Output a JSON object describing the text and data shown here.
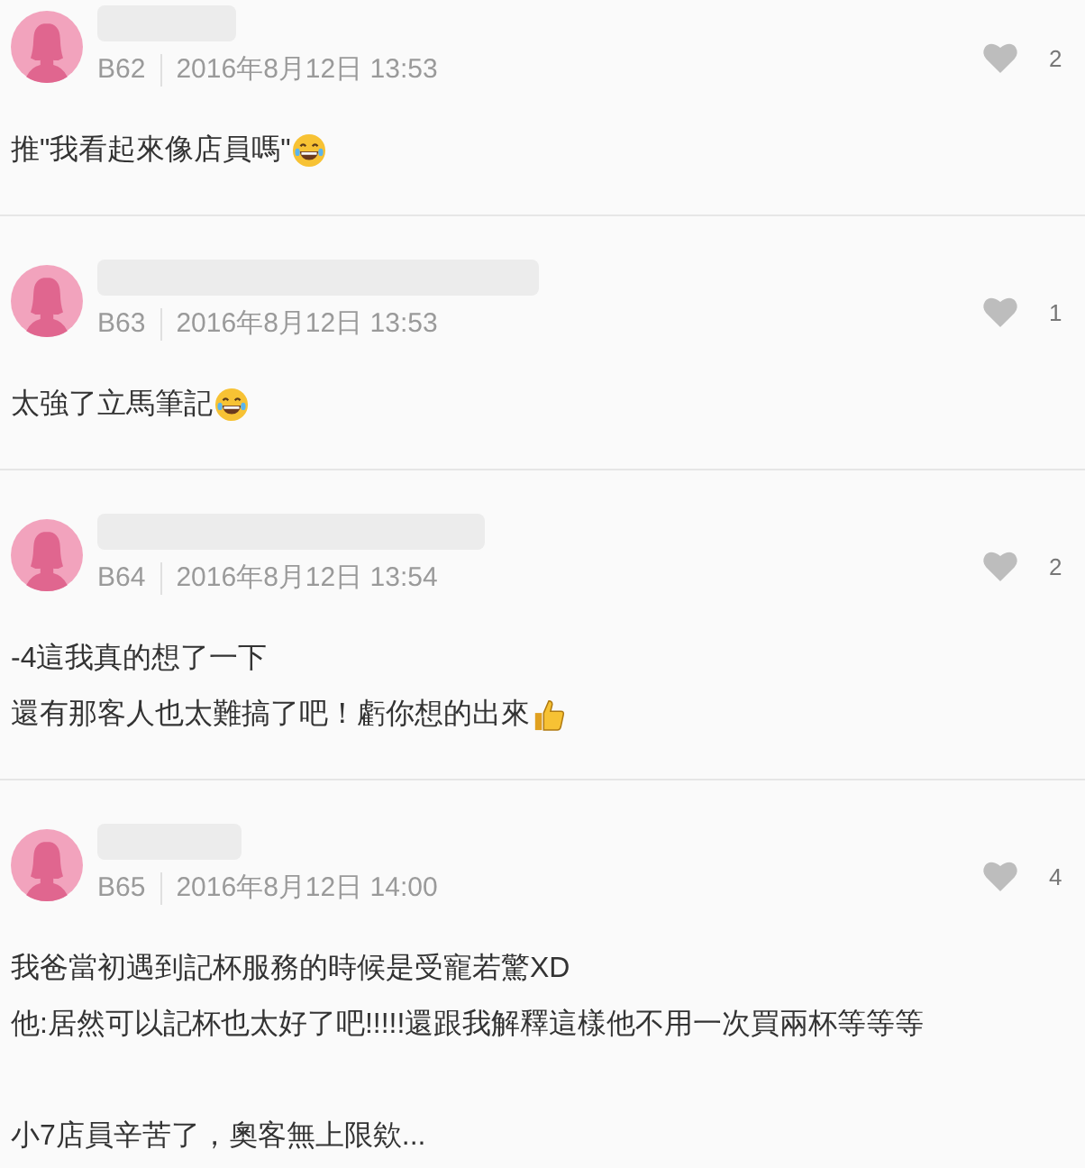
{
  "comments": [
    {
      "floor": "B62",
      "time": "2016年8月12日 13:53",
      "likes": "2",
      "paragraphs": [
        {
          "lines": [
            {
              "text": "推\"我看起來像店員嗎\" ",
              "icon": {
                "kind": "laughing"
              }
            }
          ]
        }
      ]
    },
    {
      "floor": "B63",
      "time": "2016年8月12日 13:53",
      "likes": "1",
      "paragraphs": [
        {
          "lines": [
            {
              "text": "太強了立馬筆記",
              "icon": {
                "kind": "laughing"
              }
            }
          ]
        }
      ]
    },
    {
      "floor": "B64",
      "time": "2016年8月12日 13:54",
      "likes": "2",
      "paragraphs": [
        {
          "lines": [
            {
              "text": "-4這我真的想了一下"
            },
            {
              "text": "還有那客人也太難搞了吧！虧你想的出來",
              "icon": {
                "kind": "thumbs_up"
              }
            }
          ]
        }
      ]
    },
    {
      "floor": "B65",
      "time": "2016年8月12日 14:00",
      "likes": "4",
      "paragraphs": [
        {
          "lines": [
            {
              "text": "我爸當初遇到記杯服務的時候是受寵若驚XD"
            },
            {
              "text": "他:居然可以記杯也太好了吧!!!!!還跟我解釋這樣他不用一次買兩杯等等等"
            }
          ]
        },
        {
          "lines": [
            {
              "text": "小7店員辛苦了，奧客無上限欸..."
            }
          ]
        }
      ]
    }
  ]
}
